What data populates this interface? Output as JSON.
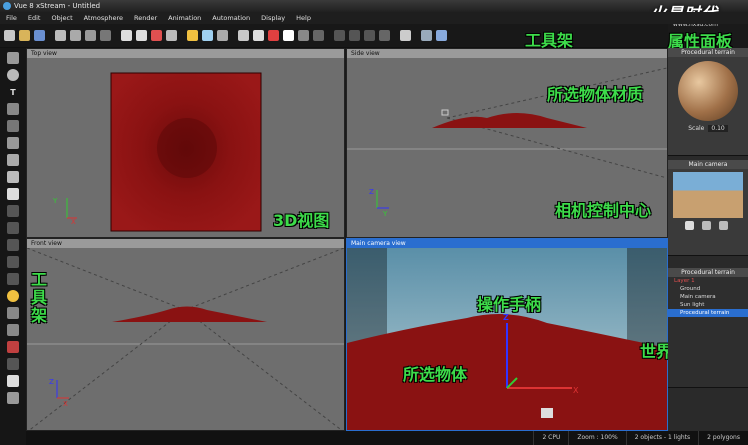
{
  "window": {
    "title": "Vue 8 xStream - Untitled"
  },
  "brand": {
    "logo": "火星时代",
    "url": "www.hxsd.com"
  },
  "menu": [
    "File",
    "Edit",
    "Object",
    "Atmosphere",
    "Render",
    "Animation",
    "Automation",
    "Display",
    "Help"
  ],
  "viewports": {
    "top": "Top view",
    "side": "Side view",
    "front": "Front view",
    "camera": "Main camera view"
  },
  "annotations": {
    "toolbar": "工具架",
    "attributes": "属性面板",
    "material": "所选物体材质",
    "views3d": "3D视图",
    "camera_center": "相机控制中心",
    "left_toolbar": "工\n具\n架",
    "manipulator": "操作手柄",
    "world_browser": "世界浏览器",
    "selected_object": "所选物体"
  },
  "right_panel": {
    "material_title": "Procedural terrain",
    "scale_label": "Scale",
    "scale_value": "0.10",
    "camera_title": "Main camera",
    "browser_title": "Procedural terrain",
    "layer": "Layer 1",
    "tree": [
      "Ground",
      "Main camera",
      "Sun light",
      "Procedural terrain"
    ]
  },
  "axes": {
    "x": "X",
    "y": "Y",
    "z": "Z"
  },
  "status": {
    "cpu": "2 CPU",
    "zoom": "Zoom : 100%",
    "objects": "2 objects - 1 lights",
    "polygons": "2 polygons"
  }
}
